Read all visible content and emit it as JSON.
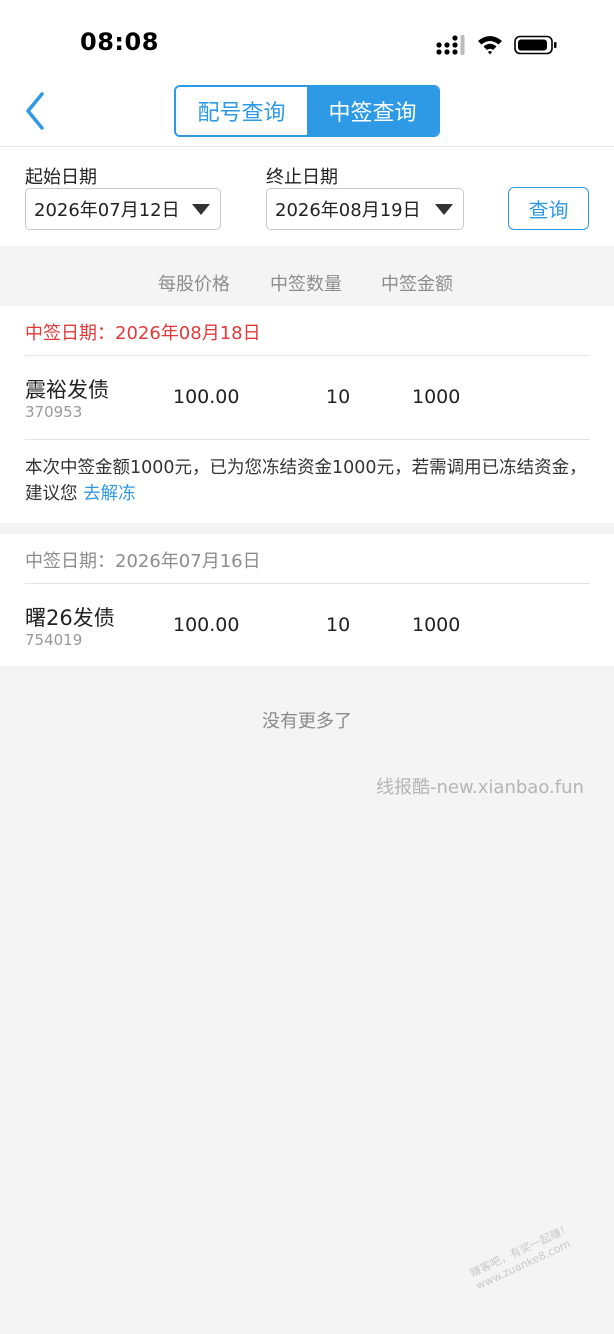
{
  "status_bar": {
    "time": "08:08"
  },
  "header": {
    "tabs": [
      {
        "label": "配号查询",
        "active": false
      },
      {
        "label": "中签查询",
        "active": true
      }
    ],
    "accent_color": "#2e9ae6"
  },
  "filters": {
    "start_label": "起始日期",
    "start_value": "2026年07月12日",
    "end_label": "终止日期",
    "end_value": "2026年08月19日",
    "query_label": "查询"
  },
  "columns": [
    "每股价格",
    "中签数量",
    "中签金额"
  ],
  "groups": [
    {
      "date_label": "中签日期：2026年08月18日",
      "date_color": "#e03a3a",
      "bond": {
        "name": "震裕发债",
        "code": "370953",
        "price": "100.00",
        "quantity": "10",
        "amount": "1000"
      },
      "notice_text": "本次中签金额1000元，已为您冻结资金1000元，若需调用已冻结资金，建议您",
      "notice_link": "去解冻"
    },
    {
      "date_label": "中签日期：2026年07月16日",
      "date_color": "#8d8d8d",
      "bond": {
        "name": "曙26发债",
        "code": "754019",
        "price": "100.00",
        "quantity": "10",
        "amount": "1000"
      }
    }
  ],
  "footer": {
    "no_more": "没有更多了"
  },
  "watermark": "线报酷-new.xianbao.fun",
  "stamp": {
    "line1": "赚客吧，有奖一起赚！",
    "line2": "www.zuanke8.com"
  }
}
